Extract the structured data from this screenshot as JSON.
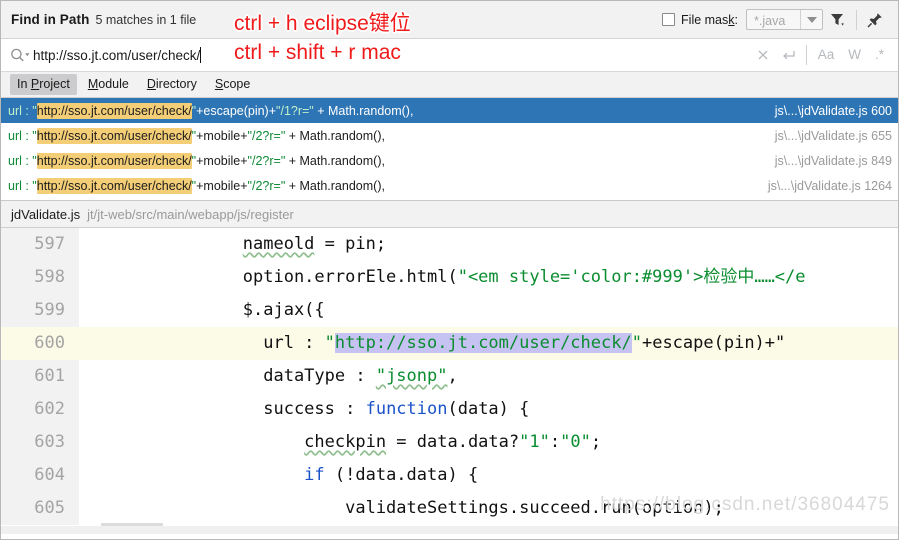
{
  "window": {
    "title": "Find in Path",
    "match_summary": "5 matches in 1 file"
  },
  "filemask": {
    "label_before": "File mas",
    "label_mnemonic": "k",
    "label_after": ":",
    "checked": false,
    "value": "*.java",
    "dropdown_icon": "chevron-down-icon",
    "filter_icon": "filter-icon",
    "pin_icon": "pin-icon"
  },
  "search": {
    "icon": "search-dropdown-icon",
    "value": "http://sso.jt.com/user/check/",
    "clear_icon": "close-icon",
    "history_icon": "return-arrow-icon",
    "options": [
      {
        "label": "Aa",
        "name": "match-case-toggle"
      },
      {
        "label": "W",
        "name": "whole-words-toggle"
      },
      {
        "label": ".*",
        "name": "regex-toggle"
      }
    ]
  },
  "scope_tabs": [
    {
      "label_a": "In ",
      "mnemonic": "P",
      "label_b": "roject",
      "selected": true,
      "name": "tab-in-project"
    },
    {
      "label_a": "",
      "mnemonic": "M",
      "label_b": "odule",
      "selected": false,
      "name": "tab-module"
    },
    {
      "label_a": "",
      "mnemonic": "D",
      "label_b": "irectory",
      "selected": false,
      "name": "tab-directory"
    },
    {
      "label_a": "",
      "mnemonic": "S",
      "label_b": "cope",
      "selected": false,
      "name": "tab-scope"
    }
  ],
  "results": [
    {
      "prefix": "url : \"",
      "match": "http://sso.jt.com/user/check/",
      "suffix_q": "\"",
      "suffix_plain": "+escape(pin)+",
      "suffix_str": "\"/1?r=\"",
      "suffix_tail": " + Math.random(),",
      "file": "js\\...\\jdValidate.js",
      "line": "600",
      "selected": true
    },
    {
      "prefix": "url : \"",
      "match": "http://sso.jt.com/user/check/",
      "suffix_q": "\"",
      "suffix_plain": "+mobile+",
      "suffix_str": "\"/2?r=\"",
      "suffix_tail": " + Math.random(),",
      "file": "js\\...\\jdValidate.js",
      "line": "655",
      "selected": false
    },
    {
      "prefix": "url : \"",
      "match": "http://sso.jt.com/user/check/",
      "suffix_q": "\"",
      "suffix_plain": "+mobile+",
      "suffix_str": "\"/2?r=\"",
      "suffix_tail": " + Math.random(),",
      "file": "js\\...\\jdValidate.js",
      "line": "849",
      "selected": false
    },
    {
      "prefix": "url : \"",
      "match": "http://sso.jt.com/user/check/",
      "suffix_q": "\"",
      "suffix_plain": "+mobile+",
      "suffix_str": "\"/2?r=\"",
      "suffix_tail": " + Math.random(),",
      "file": "js\\...\\jdValidate.js",
      "line": "1264",
      "selected": false
    }
  ],
  "breadcrumb": {
    "file": "jdValidate.js",
    "path": "jt/jt-web/src/main/webapp/js/register"
  },
  "editor": {
    "active_line": "600",
    "lines": [
      {
        "num": "597"
      },
      {
        "num": "598"
      },
      {
        "num": "599"
      },
      {
        "num": "600"
      },
      {
        "num": "601"
      },
      {
        "num": "602"
      },
      {
        "num": "603"
      },
      {
        "num": "604"
      },
      {
        "num": "605"
      }
    ],
    "code": {
      "l597_a": "nameold",
      "l597_b": " = pin;",
      "l598_a": "option.errorEle.html(",
      "l598_str": "\"<em style='color:#999'>检验中……</e",
      "l599": "$.ajax({",
      "l600_a": "url : ",
      "l600_q1": "\"",
      "l600_url": "http://sso.jt.com/user/check/",
      "l600_q2": "\"",
      "l600_b": "+escape(pin)+\"",
      "l601_a": "dataType : ",
      "l601_str": "\"jsonp\"",
      "l601_b": ",",
      "l602_a": "success : ",
      "l602_kw": "function",
      "l602_b": "(data) {",
      "l603_a": "checkpin",
      "l603_b": " = data.data?",
      "l603_s1": "\"1\"",
      "l603_c": ":",
      "l603_s2": "\"0\"",
      "l603_d": ";",
      "l604_kw": "if",
      "l604_b": " (!data.data) {",
      "l605": "validateSettings.succeed.run(option);"
    }
  },
  "annotations": [
    {
      "text": "ctrl + h  eclipse键位",
      "name": "annotation-eclipse-shortcut"
    },
    {
      "text": "ctrl + shift + r   mac",
      "name": "annotation-mac-shortcut"
    }
  ],
  "watermark": {
    "text": "https://blog.csdn.net/36804475"
  },
  "colors": {
    "selection_blue": "#2e75b6",
    "match_highlight": "#f4ce77",
    "active_line": "#fcfbe8",
    "url_selection": "#c6c2f2",
    "annotation_red": "#ef1b1b",
    "string_green": "#0a8c2f",
    "keyword_blue": "#1a53c9"
  }
}
